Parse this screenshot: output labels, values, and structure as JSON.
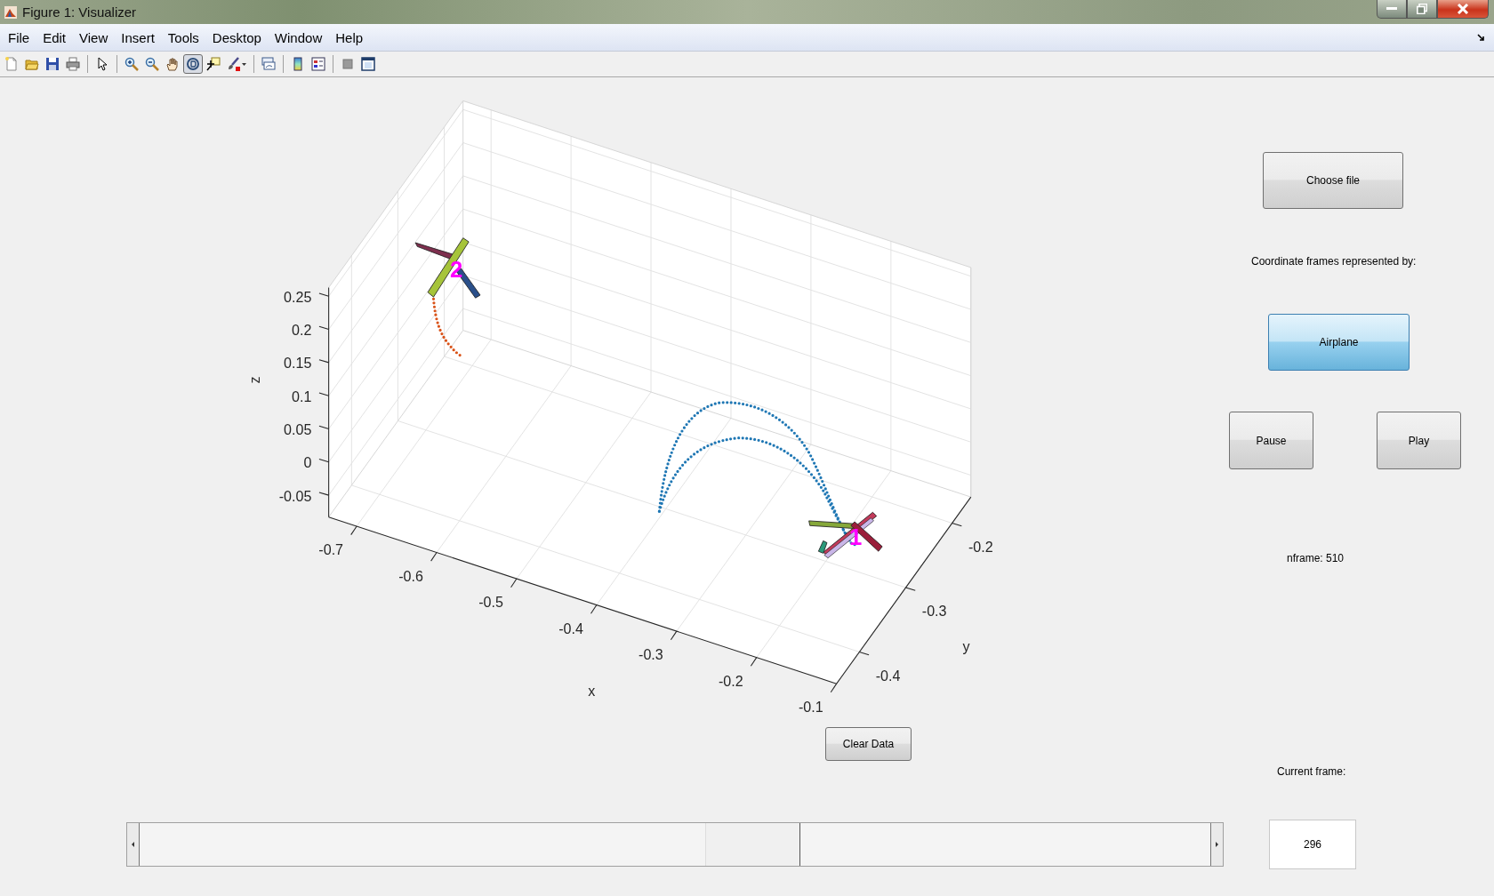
{
  "window": {
    "title": "Figure 1: Visualizer"
  },
  "menu": [
    "File",
    "Edit",
    "View",
    "Insert",
    "Tools",
    "Desktop",
    "Window",
    "Help"
  ],
  "toolbar_groups": [
    {
      "tools": [
        {
          "kind": "new",
          "selected": false
        },
        {
          "kind": "open",
          "selected": false
        },
        {
          "kind": "save",
          "selected": false
        },
        {
          "kind": "print",
          "selected": false
        }
      ]
    },
    {
      "tools": [
        {
          "kind": "pointer",
          "selected": false
        }
      ]
    },
    {
      "tools": [
        {
          "kind": "zoom-in",
          "selected": false
        },
        {
          "kind": "zoom-out",
          "selected": false
        },
        {
          "kind": "pan",
          "selected": false
        },
        {
          "kind": "rotate",
          "selected": true
        },
        {
          "kind": "data-cursor",
          "selected": false
        },
        {
          "kind": "brush",
          "selected": false
        }
      ]
    },
    {
      "tools": [
        {
          "kind": "link",
          "selected": false
        }
      ]
    },
    {
      "tools": [
        {
          "kind": "colorbar",
          "selected": false
        },
        {
          "kind": "legend",
          "selected": false
        }
      ]
    },
    {
      "tools": [
        {
          "kind": "hide",
          "selected": false
        },
        {
          "kind": "dock",
          "selected": false
        }
      ]
    }
  ],
  "plot": {
    "x_axis": {
      "label": "x",
      "ticks": [
        "-0.7",
        "-0.6",
        "-0.5",
        "-0.4",
        "-0.3",
        "-0.2",
        "-0.1"
      ]
    },
    "y_axis": {
      "label": "y",
      "ticks": [
        "-0.4",
        "-0.3",
        "-0.2"
      ]
    },
    "z_axis": {
      "label": "z",
      "ticks": [
        "0.25",
        "0.2",
        "0.15",
        "0.1",
        "0.05",
        "0",
        "-0.05"
      ]
    },
    "frame_labels": [
      "2",
      "1"
    ]
  },
  "clear_button": "Clear Data",
  "panel": {
    "choose_button": "Choose file",
    "frames_label": "Coordinate frames represented by:",
    "frame_toggle": {
      "label": "Airplane",
      "selected": true
    },
    "pause_button": "Pause",
    "play_button": "Play",
    "nframe": "nframe: 510",
    "current_label": "Current frame:"
  },
  "frame_slider": {
    "level": 0.58
  },
  "current_frame": {
    "value": "296"
  }
}
